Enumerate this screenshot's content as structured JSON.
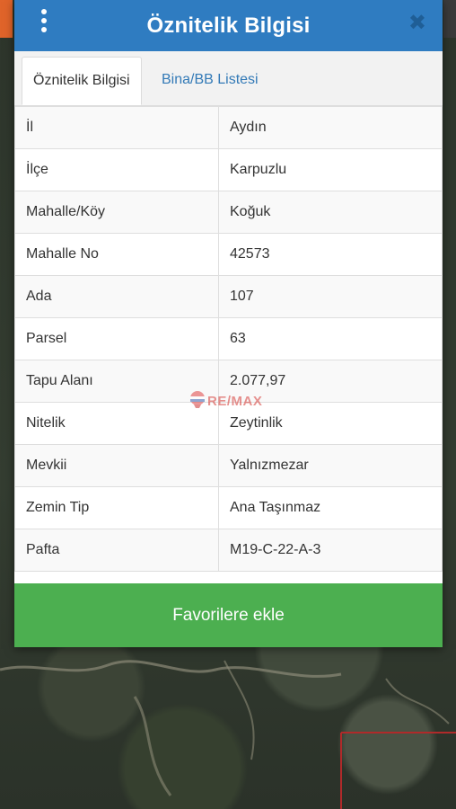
{
  "header": {
    "title": "Öznitelik Bilgisi",
    "close_glyph": "✖"
  },
  "tabs": [
    {
      "label": "Öznitelik Bilgisi",
      "active": true
    },
    {
      "label": "Bina/BB Listesi",
      "active": false
    }
  ],
  "rows": [
    {
      "key": "İl",
      "value": "Aydın"
    },
    {
      "key": "İlçe",
      "value": "Karpuzlu"
    },
    {
      "key": "Mahalle/Köy",
      "value": "Koğuk"
    },
    {
      "key": "Mahalle No",
      "value": "42573"
    },
    {
      "key": "Ada",
      "value": "107"
    },
    {
      "key": "Parsel",
      "value": "63"
    },
    {
      "key": "Tapu Alanı",
      "value": "2.077,97"
    },
    {
      "key": "Nitelik",
      "value": "Zeytinlik"
    },
    {
      "key": "Mevkii",
      "value": "Yalnızmezar"
    },
    {
      "key": "Zemin Tip",
      "value": "Ana Taşınmaz"
    },
    {
      "key": "Pafta",
      "value": "M19-C-22-A-3"
    }
  ],
  "favorite_button": {
    "label": "Favorilere ekle"
  },
  "watermark": {
    "text": "RE/MAX"
  },
  "colors": {
    "header": "#2f7cc1",
    "button": "#4caf50",
    "link": "#337ab7"
  },
  "icons": {
    "menu": "more-vertical-icon",
    "close": "close-icon",
    "watermark": "balloon-icon"
  }
}
